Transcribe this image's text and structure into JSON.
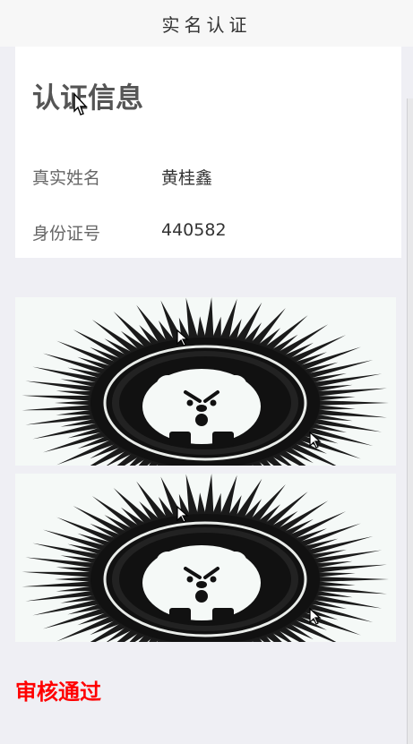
{
  "header": {
    "title": "实名认证"
  },
  "card": {
    "title": "认证信息",
    "rows": [
      {
        "label": "真实姓名",
        "value": "黄桂鑫"
      },
      {
        "label": "身份证号",
        "value": "440582"
      }
    ]
  },
  "photos": [
    {
      "icon": "hedgehog-illustration"
    },
    {
      "icon": "hedgehog-illustration"
    }
  ],
  "status": {
    "text": "审核通过",
    "color": "#ff0000"
  }
}
